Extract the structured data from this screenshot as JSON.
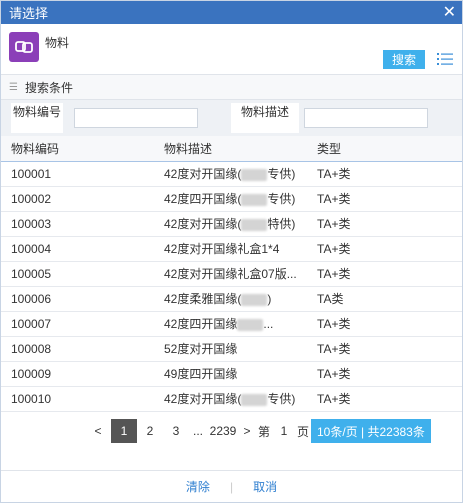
{
  "title": "请选择",
  "app": {
    "name": "物料",
    "icon": "link-icon"
  },
  "search_label": "搜索",
  "conditions_label": "搜索条件",
  "filters": {
    "code_label": "物料编号",
    "desc_label": "物料描述",
    "code_value": "",
    "desc_value": ""
  },
  "table": {
    "headers": [
      "物料编码",
      "物料描述",
      "类型"
    ],
    "rows": [
      {
        "code": "100001",
        "desc": "42度对开国缘(",
        "desc_tail": "专供)",
        "blur": true,
        "type": "TA+类"
      },
      {
        "code": "100002",
        "desc": "42度四开国缘(",
        "desc_tail": "专供)",
        "blur": true,
        "type": "TA+类"
      },
      {
        "code": "100003",
        "desc": "42度对开国缘(",
        "desc_tail": "特供)",
        "blur": true,
        "type": "TA+类"
      },
      {
        "code": "100004",
        "desc": "42度对开国缘礼盒1*4",
        "desc_tail": "",
        "blur": false,
        "type": "TA+类"
      },
      {
        "code": "100005",
        "desc": "42度对开国缘礼盒07版...",
        "desc_tail": "",
        "blur": false,
        "type": "TA+类"
      },
      {
        "code": "100006",
        "desc": "42度柔雅国缘(",
        "desc_tail": ")",
        "blur": true,
        "type": "TA类"
      },
      {
        "code": "100007",
        "desc": "42度四开国缘",
        "desc_tail": "...",
        "blur": true,
        "type": "TA+类"
      },
      {
        "code": "100008",
        "desc": "52度对开国缘",
        "desc_tail": "",
        "blur": false,
        "type": "TA+类"
      },
      {
        "code": "100009",
        "desc": "49度四开国缘",
        "desc_tail": "",
        "blur": false,
        "type": "TA+类"
      },
      {
        "code": "100010",
        "desc": "42度对开国缘(",
        "desc_tail": "专供)",
        "blur": true,
        "type": "TA+类"
      }
    ]
  },
  "pager": {
    "prev": "<",
    "pages": [
      "1",
      "2",
      "3"
    ],
    "ellipsis": "...",
    "last": "2239",
    "next": ">",
    "goto_prefix": "第",
    "goto_value": "1",
    "goto_suffix": "页",
    "info": "10条/页 | 共22383条"
  },
  "footer": {
    "clear": "清除",
    "cancel": "取消"
  },
  "colors": {
    "titlebar": "#3a73bf",
    "accent": "#3fb0ec",
    "app_icon": "#8b3fb8"
  }
}
